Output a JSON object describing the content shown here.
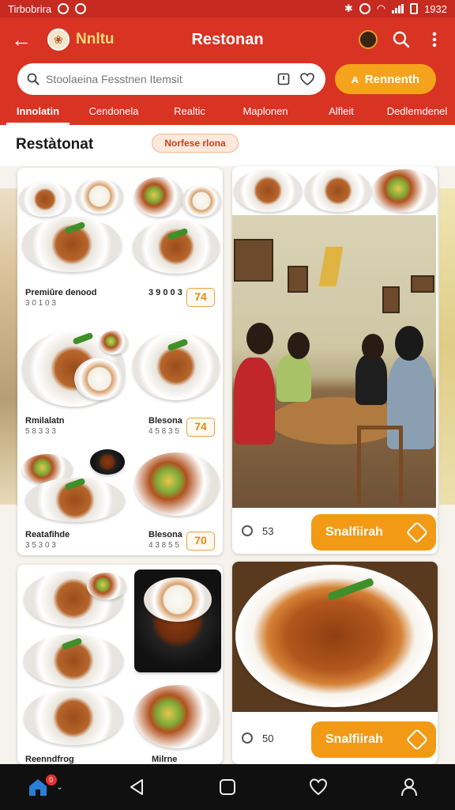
{
  "status_bar": {
    "left_text": "Tirbobrira",
    "time": "1932"
  },
  "app_bar": {
    "brand": "Nnltu",
    "title": "Restonan"
  },
  "search": {
    "placeholder": "Stoolaeina Fesstnen Itemsit",
    "button_label": "Rennenth"
  },
  "tabs": [
    "Innolatin",
    "Cendonela",
    "Realtic",
    "Maplonen",
    "Alfleit",
    "Dedlemdenel"
  ],
  "section": {
    "title": "Restàtonat",
    "chip": "Norfese rlona"
  },
  "menu_items": [
    {
      "name": "Premiûre denood",
      "sub": "3 0 1 0 3",
      "price": "3 9 0 0 3",
      "rating": "74"
    },
    {
      "name": "Rmilalatn",
      "sub": "5 8 3 3 3",
      "price": "Blesona",
      "price_sub": "4 5 8 3 5",
      "rating": "74"
    },
    {
      "name": "Reatafihde",
      "sub": "3 5 3 0 3",
      "price": "Blesona",
      "price_sub": "4 3 8 5 5",
      "rating": "70"
    },
    {
      "name": "Reenndfrog",
      "price": "Milrne"
    }
  ],
  "restaurant_cards": [
    {
      "count": "53",
      "button": "Snalfiirah"
    },
    {
      "count": "50",
      "button": "Snalfiirah"
    }
  ],
  "colors": {
    "primary": "#d93323",
    "accent": "#f29a16",
    "nav_bg": "#101010"
  },
  "nav": {
    "home_badge": "0"
  }
}
